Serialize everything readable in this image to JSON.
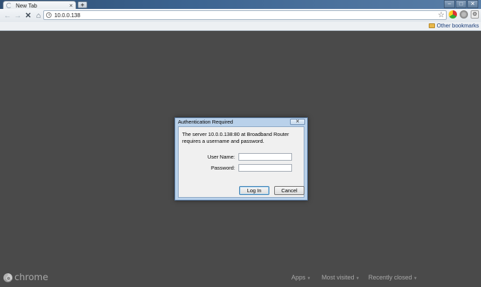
{
  "browser": {
    "tab_title": "New Tab",
    "new_tab_symbol": "+",
    "url": "10.0.0.138",
    "bookmarks_label": "Other bookmarks",
    "window_controls": [
      "–",
      "□",
      "✕"
    ]
  },
  "dialog": {
    "title": "Authentication Required",
    "message": "The server 10.0.0.138:80 at Broadband Router requires a username and password.",
    "username_label": "User Name:",
    "password_label": "Password:",
    "username_value": "",
    "password_value": "",
    "login_label": "Log In",
    "cancel_label": "Cancel",
    "close_symbol": "✕"
  },
  "footer": {
    "logo_text": "chrome",
    "apps_label": "Apps",
    "most_visited_label": "Most visited",
    "recently_closed_label": "Recently closed"
  },
  "icons": {
    "back": "back-arrow-icon",
    "forward": "forward-arrow-icon",
    "stop": "stop-icon",
    "home": "home-icon",
    "star": "star-icon",
    "folder": "folder-icon"
  },
  "colors": {
    "content_bg": "#4a4a4a",
    "dialog_frame": "#b9d1ea",
    "link_blue": "#1a3d7a"
  }
}
